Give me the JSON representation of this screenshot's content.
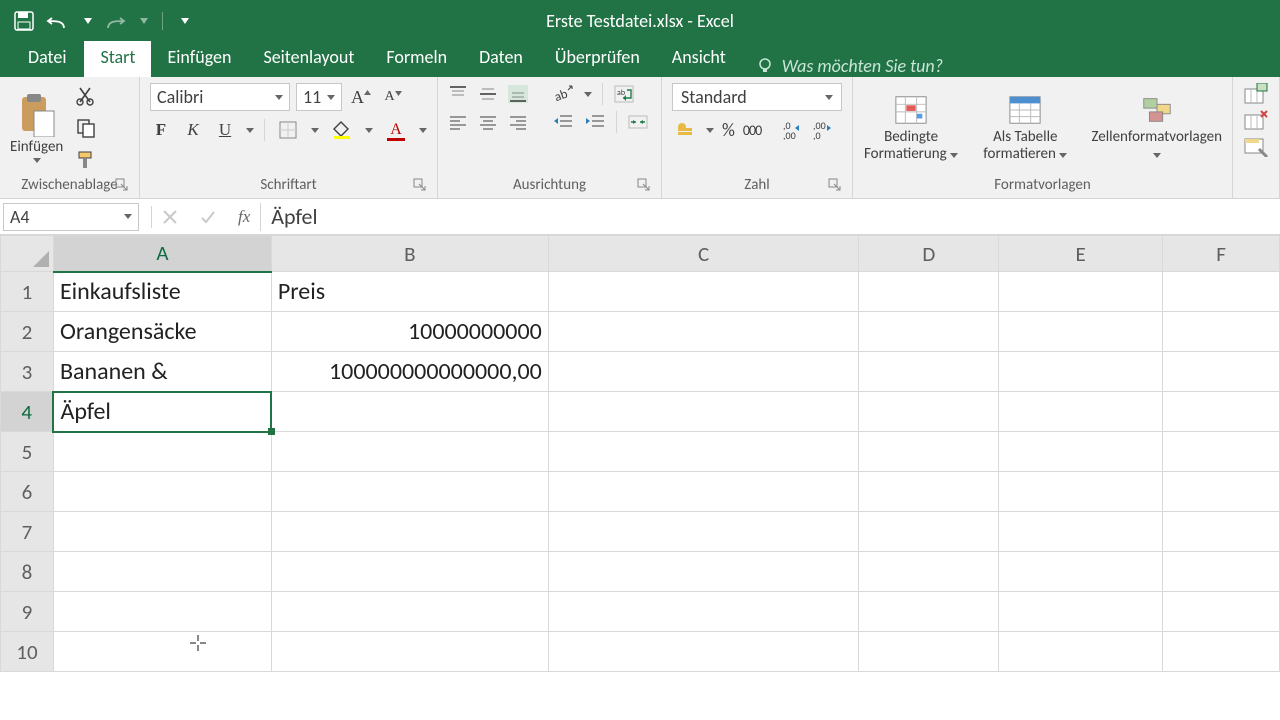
{
  "app": {
    "title": "Erste Testdatei.xlsx - Excel"
  },
  "tabs": {
    "file": "Datei",
    "home": "Start",
    "insert": "Einfügen",
    "pagelayout": "Seitenlayout",
    "formulas": "Formeln",
    "data": "Daten",
    "review": "Überprüfen",
    "view": "Ansicht",
    "tellme": "Was möchten Sie tun?"
  },
  "ribbon": {
    "clipboard": {
      "paste": "Einfügen",
      "label": "Zwischenablage"
    },
    "font": {
      "name": "Calibri",
      "size": "11",
      "label": "Schriftart",
      "bold": "F",
      "italic": "K",
      "underline": "U"
    },
    "alignment": {
      "label": "Ausrichtung"
    },
    "number": {
      "format": "Standard",
      "label": "Zahl",
      "thousands": "000"
    },
    "styles": {
      "conditional": "Bedingte Formatierung",
      "table": "Als Tabelle formatieren",
      "cellstyles": "Zellenformatvorlagen",
      "label": "Formatvorlagen"
    }
  },
  "formula_bar": {
    "cell_ref": "A4",
    "formula": "Äpfel",
    "fx": "fx"
  },
  "columns": [
    "A",
    "B",
    "C",
    "D",
    "E",
    "F"
  ],
  "rows": [
    "1",
    "2",
    "3",
    "4",
    "5",
    "6",
    "7",
    "8",
    "9",
    "10"
  ],
  "cells": {
    "A1": "Einkaufsliste",
    "B1": "Preis",
    "A2": "Orangensäcke",
    "B2": "10000000000",
    "A3": "Bananen &",
    "B3": "100000000000000,00",
    "A4": "Äpfel"
  },
  "selection": {
    "col": "A",
    "row": "4"
  }
}
